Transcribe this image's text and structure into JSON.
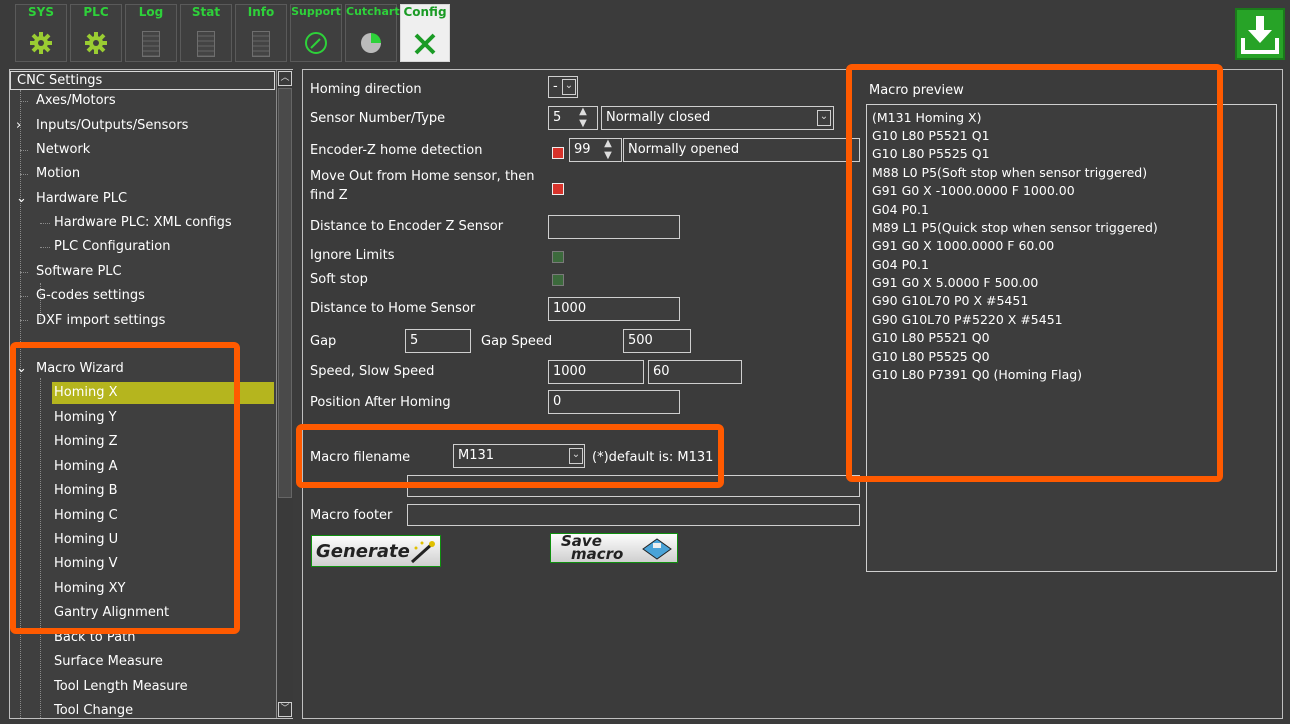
{
  "toolbar": {
    "tabs": [
      {
        "label": "SYS",
        "icon": "gear-icon"
      },
      {
        "label": "PLC",
        "icon": "gear-icon"
      },
      {
        "label": "Log",
        "icon": "document-icon"
      },
      {
        "label": "Stat",
        "icon": "document-icon"
      },
      {
        "label": "Info",
        "icon": "document-icon"
      },
      {
        "label": "Support",
        "icon": "gauge-icon"
      },
      {
        "label": "Cutchart",
        "icon": "chart-icon"
      },
      {
        "label": "Config",
        "icon": "tools-icon"
      }
    ],
    "save_icon": "download-icon"
  },
  "tree": {
    "header": "CNC Settings",
    "items": [
      {
        "label": "Axes/Motors"
      },
      {
        "label": "Inputs/Outputs/Sensors"
      },
      {
        "label": "Network"
      },
      {
        "label": "Motion"
      },
      {
        "label": "Hardware PLC"
      },
      {
        "label": "Hardware PLC: XML configs"
      },
      {
        "label": "PLC Configuration"
      },
      {
        "label": "Software PLC"
      },
      {
        "label": "G-codes settings"
      },
      {
        "label": "DXF import settings"
      },
      {
        "label": "Macro Wizard"
      },
      {
        "label": "Homing X"
      },
      {
        "label": "Homing Y"
      },
      {
        "label": "Homing Z"
      },
      {
        "label": "Homing A"
      },
      {
        "label": "Homing B"
      },
      {
        "label": "Homing C"
      },
      {
        "label": "Homing U"
      },
      {
        "label": "Homing V"
      },
      {
        "label": "Homing XY"
      },
      {
        "label": "Gantry Alignment"
      },
      {
        "label": "Back to Path"
      },
      {
        "label": "Surface Measure"
      },
      {
        "label": "Tool Length Measure"
      },
      {
        "label": "Tool Change"
      }
    ]
  },
  "form": {
    "homing_direction_label": "Homing direction",
    "homing_direction_value": "-",
    "sensor_label": "Sensor Number/Type",
    "sensor_number": "5",
    "sensor_type": "Normally closed",
    "encoder_label": "Encoder-Z home detection",
    "encoder_number": "99",
    "encoder_type": "Normally opened",
    "move_out_label_1": "Move Out from Home sensor, then",
    "move_out_label_2": "find Z",
    "distance_encoder_label": "Distance to Encoder Z Sensor",
    "distance_encoder_value": "",
    "ignore_limits_label": "Ignore Limits",
    "soft_stop_label": "Soft stop",
    "distance_home_label": "Distance to Home Sensor",
    "distance_home_value": "1000",
    "gap_label": "Gap",
    "gap_value": "5",
    "gap_speed_label": "Gap Speed",
    "gap_speed_value": "500",
    "speed_label": "Speed, Slow Speed",
    "speed_value": "1000",
    "slow_speed_value": "60",
    "position_label": "Position After Homing",
    "position_value": "0",
    "macro_filename_label": "Macro filename",
    "macro_filename_value": "M131",
    "default_note": "(*)default is: M131",
    "macro_footer_label": "Macro footer",
    "macro_footer_value": "",
    "generate_label": "Generate",
    "save_label_1": "Save",
    "save_label_2": "macro"
  },
  "preview": {
    "title": "Macro preview",
    "lines": [
      "(M131 Homing X)",
      "G10 L80 P5521 Q1",
      "G10 L80 P5525 Q1",
      "M88 L0 P5(Soft stop when sensor triggered)",
      "G91 G0 X -1000.0000 F  1000.00",
      "G04 P0.1",
      "M89 L1 P5(Quick stop when sensor triggered)",
      "G91 G0 X  1000.0000 F    60.00",
      "G04 P0.1",
      "G91 G0 X     5.0000 F   500.00",
      "G90 G10L70 P0 X #5451",
      "G90 G10L70 P#5220 X #5451",
      "G10 L80 P5521 Q0",
      "G10 L80 P5525 Q0",
      "G10 L80 P7391 Q0 (Homing Flag)"
    ]
  },
  "colors": {
    "accent": "#ff5a00",
    "tab_green": "#2ed13a",
    "selection": "#b5b51e"
  }
}
